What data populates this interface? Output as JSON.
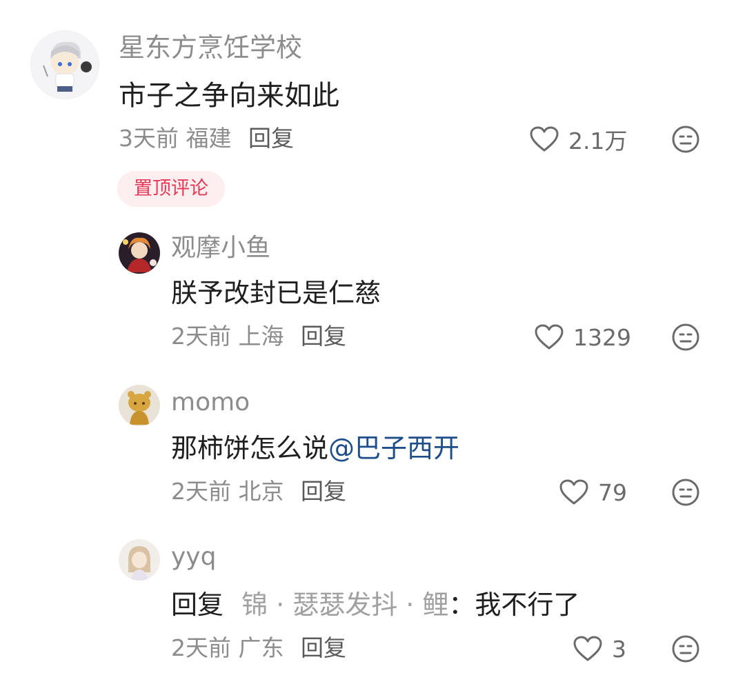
{
  "comments": [
    {
      "username": "星东方烹饪学校",
      "content": "市子之争向来如此",
      "time": "3天前",
      "location": "福建",
      "reply_label": "回复",
      "likes": "2.1万",
      "pinned_label": "置顶评论"
    },
    {
      "username": "观摩小鱼",
      "content": "朕予改封已是仁慈",
      "time": "2天前",
      "location": "上海",
      "reply_label": "回复",
      "likes": "1329"
    },
    {
      "username": "momo",
      "content": "那柿饼怎么说",
      "mention": "@巴子西开",
      "time": "2天前",
      "location": "北京",
      "reply_label": "回复",
      "likes": "79"
    },
    {
      "username": "yyq",
      "reply_prefix": "回复",
      "quoted_user_a": "锦",
      "quoted_separator": "·",
      "quoted_user_b": "瑟瑟发抖",
      "quoted_user_c": "鲤",
      "colon": "：",
      "content": "我不行了",
      "time": "2天前",
      "location": "广东",
      "reply_label": "回复",
      "likes": "3"
    }
  ],
  "icons": {
    "like": "heart-outline-icon",
    "dislike": "neutral-face-icon"
  },
  "colors": {
    "pinned_text": "#e53956",
    "pinned_bg": "#fdeef0",
    "mention": "#1e4e8a",
    "meta_gray": "#8c8c8c"
  }
}
